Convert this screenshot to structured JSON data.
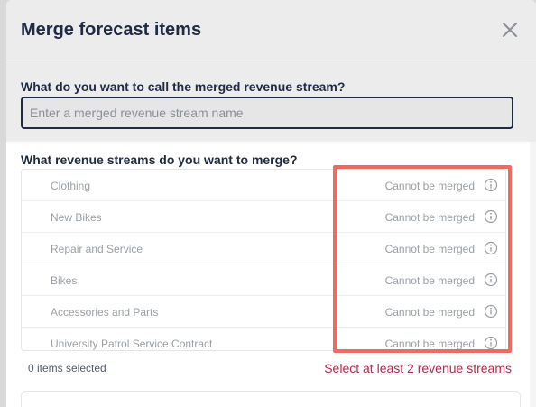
{
  "modal": {
    "title": "Merge forecast items"
  },
  "name_section": {
    "question": "What do you want to call the merged revenue stream?",
    "input_value": "",
    "input_placeholder": "Enter a merged revenue stream name"
  },
  "merge_section": {
    "question": "What revenue streams do you want to merge?",
    "items": [
      {
        "name": "Clothing",
        "status": "Cannot be merged"
      },
      {
        "name": "New Bikes",
        "status": "Cannot be merged"
      },
      {
        "name": "Repair and Service",
        "status": "Cannot be merged"
      },
      {
        "name": "Bikes",
        "status": "Cannot be merged"
      },
      {
        "name": "Accessories and Parts",
        "status": "Cannot be merged"
      },
      {
        "name": "University Patrol Service Contract",
        "status": "Cannot be merged"
      }
    ],
    "selected_count": "0 items selected",
    "error_message": "Select at least 2 revenue streams"
  },
  "colors": {
    "title": "#1f2a44",
    "error": "#c0264b",
    "highlight": "#f06b5e",
    "muted": "#9aa0a8"
  }
}
